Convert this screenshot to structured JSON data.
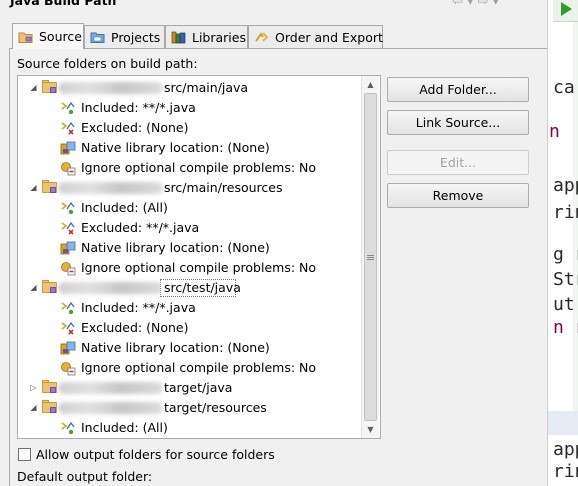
{
  "window": {
    "title": "Java Build Path"
  },
  "tabs": [
    {
      "label": "Source",
      "icon": "source-folder-icon",
      "active": true
    },
    {
      "label": "Projects",
      "icon": "projects-icon",
      "active": false
    },
    {
      "label": "Libraries",
      "icon": "libraries-icon",
      "active": false
    },
    {
      "label": "Order and Export",
      "icon": "order-export-icon",
      "active": false
    }
  ],
  "source_panel": {
    "heading": "Source folders on build path:",
    "tree": [
      {
        "path": "src/main/java",
        "expanded": true,
        "children": [
          {
            "label": "Included: **/*.java",
            "icon": "include-filter-icon"
          },
          {
            "label": "Excluded: (None)",
            "icon": "exclude-filter-icon"
          },
          {
            "label": "Native library location: (None)",
            "icon": "native-library-icon"
          },
          {
            "label": "Ignore optional compile problems: No",
            "icon": "ignore-problems-icon"
          }
        ]
      },
      {
        "path": "src/main/resources",
        "expanded": true,
        "children": [
          {
            "label": "Included: (All)",
            "icon": "include-filter-icon"
          },
          {
            "label": "Excluded: **/*.java",
            "icon": "exclude-filter-icon"
          },
          {
            "label": "Native library location: (None)",
            "icon": "native-library-icon"
          },
          {
            "label": "Ignore optional compile problems: No",
            "icon": "ignore-problems-icon"
          }
        ]
      },
      {
        "path": "src/test/java",
        "expanded": true,
        "focused": true,
        "children": [
          {
            "label": "Included: **/*.java",
            "icon": "include-filter-icon"
          },
          {
            "label": "Excluded: (None)",
            "icon": "exclude-filter-icon"
          },
          {
            "label": "Native library location: (None)",
            "icon": "native-library-icon"
          },
          {
            "label": "Ignore optional compile problems: No",
            "icon": "ignore-problems-icon"
          }
        ]
      },
      {
        "path": "target/java",
        "expanded": false,
        "children": []
      },
      {
        "path": "target/resources",
        "expanded": true,
        "children": [
          {
            "label": "Included: (All)",
            "icon": "include-filter-icon"
          }
        ]
      }
    ],
    "buttons": {
      "add_folder": "Add Folder...",
      "link_source": "Link Source...",
      "edit": "Edit...",
      "remove": "Remove"
    },
    "allow_output_folders_label": "Allow output folders for source folders",
    "allow_output_folders_checked": false,
    "default_output_folder_label": "Default output folder:"
  },
  "editor_fragments": [
    {
      "text": "ca",
      "color": "#2a2a2a"
    },
    {
      "text": "n",
      "color": "#7f0055"
    },
    {
      "text": "app",
      "color": "#2a2a2a"
    },
    {
      "text": "rin",
      "color": "#2a2a2a"
    },
    {
      "text": "g r",
      "color": "#2a2a2a"
    },
    {
      "text": "Str",
      "color": "#2a2a2a"
    },
    {
      "text": "ut",
      "color": "#2a2a2a"
    },
    {
      "text": "n r",
      "color": "#7f0055"
    },
    {
      "text": "app",
      "color": "#2a2a2a"
    },
    {
      "text": "rin",
      "color": "#2a2a2a"
    }
  ],
  "colors": {
    "dialog_bg": "#f0f0f0",
    "run_green": "#2e9c2e",
    "keyword": "#7f0055"
  }
}
